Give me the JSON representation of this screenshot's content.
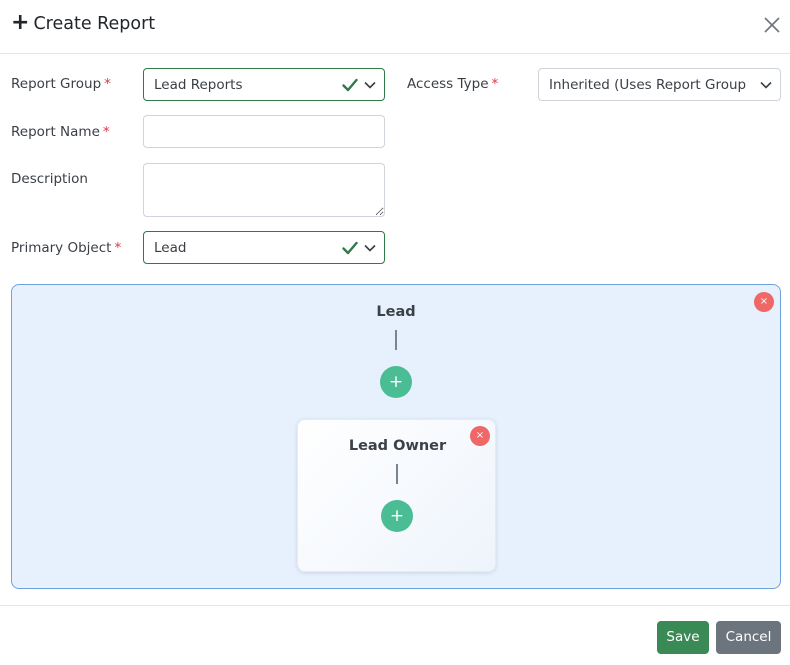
{
  "modal": {
    "title": "Create Report"
  },
  "form": {
    "report_group": {
      "label": "Report Group",
      "required": "*",
      "value": "Lead Reports"
    },
    "access_type": {
      "label": "Access Type",
      "required": "*",
      "value": "Inherited (Uses Report Group Pe"
    },
    "report_name": {
      "label": "Report Name",
      "required": "*",
      "value": ""
    },
    "description": {
      "label": "Description",
      "value": ""
    },
    "primary_object": {
      "label": "Primary Object",
      "required": "*",
      "value": "Lead"
    }
  },
  "diagram": {
    "root_node": {
      "title": "Lead",
      "add_symbol": "+",
      "remove_symbol": "×"
    },
    "child_node": {
      "title": "Lead Owner",
      "add_symbol": "+",
      "remove_symbol": "×"
    }
  },
  "footer": {
    "save_label": "Save",
    "cancel_label": "Cancel"
  },
  "colors": {
    "valid": "#2f7a4a",
    "required": "#dc3545",
    "save": "#3a8a56",
    "cancel": "#6c757d",
    "add": "#4bbd94",
    "remove": "#f06767",
    "canvas_bg": "#e7f1fd"
  }
}
